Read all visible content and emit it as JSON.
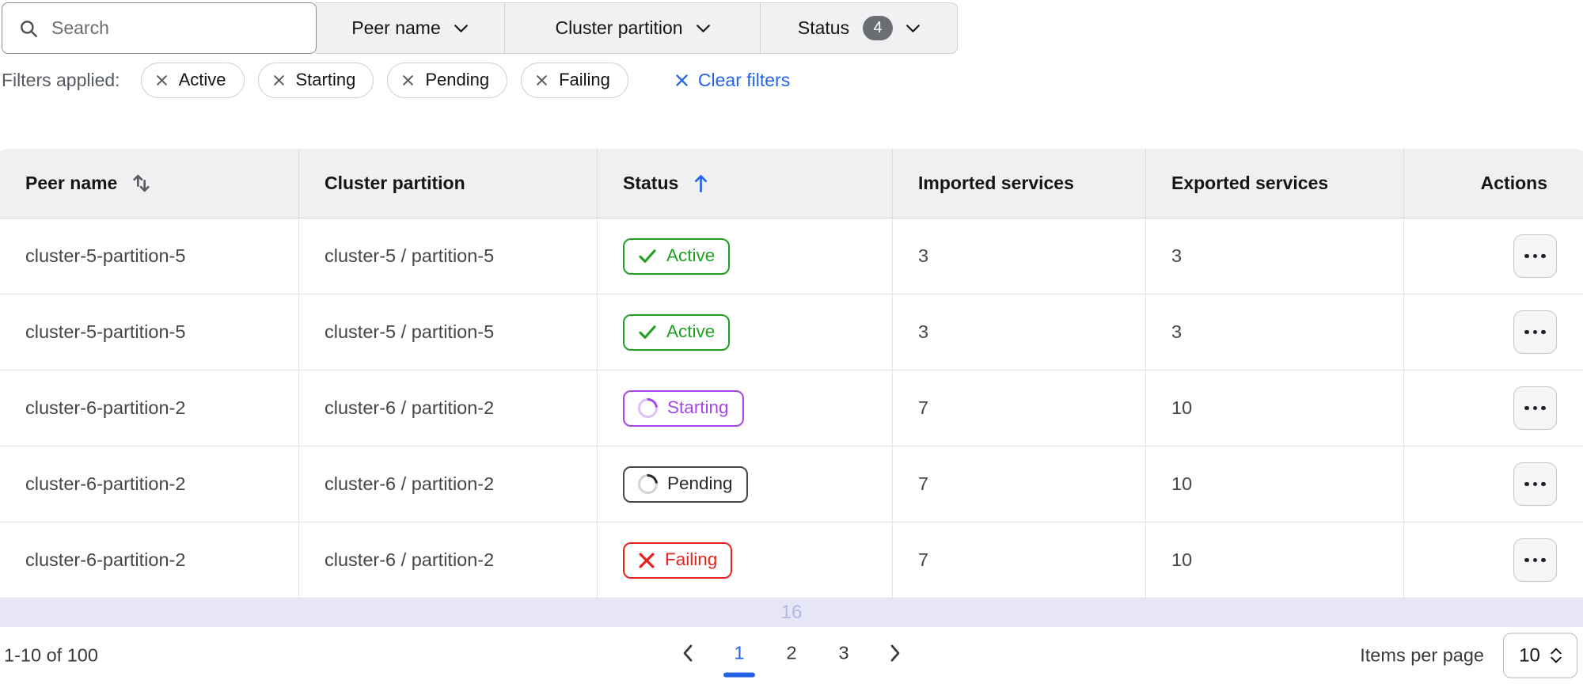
{
  "toolbar": {
    "search": {
      "placeholder": "Search",
      "icon": "search-icon"
    },
    "filters": [
      {
        "label": "Peer name",
        "icon": "chevron-down-icon"
      },
      {
        "label": "Cluster partition",
        "icon": "chevron-down-icon"
      },
      {
        "label": "Status",
        "badge_count": "4",
        "icon": "chevron-down-icon"
      }
    ]
  },
  "applied_filters": {
    "label": "Filters applied:",
    "chips": [
      {
        "label": "Active",
        "icon": "close-icon"
      },
      {
        "label": "Starting",
        "icon": "close-icon"
      },
      {
        "label": "Pending",
        "icon": "close-icon"
      },
      {
        "label": "Failing",
        "icon": "close-icon"
      }
    ],
    "clear_label": "Clear filters"
  },
  "table": {
    "columns": [
      {
        "label": "Peer name",
        "sort": "sortable"
      },
      {
        "label": "Cluster partition",
        "sort": "none"
      },
      {
        "label": "Status",
        "sort": "ascending"
      },
      {
        "label": "Imported services",
        "sort": "none"
      },
      {
        "label": "Exported services",
        "sort": "none"
      },
      {
        "label": "Actions",
        "sort": "none"
      }
    ],
    "rows": [
      {
        "peer_name": "cluster-5-partition-5",
        "cluster_partition": "cluster-5 / partition-5",
        "status": "Active",
        "imported": "3",
        "exported": "3",
        "actions_icon": "ellipsis-icon"
      },
      {
        "peer_name": "cluster-5-partition-5",
        "cluster_partition": "cluster-5 / partition-5",
        "status": "Active",
        "imported": "3",
        "exported": "3",
        "actions_icon": "ellipsis-icon"
      },
      {
        "peer_name": "cluster-6-partition-2",
        "cluster_partition": "cluster-6 / partition-2",
        "status": "Starting",
        "imported": "7",
        "exported": "10",
        "actions_icon": "ellipsis-icon"
      },
      {
        "peer_name": "cluster-6-partition-2",
        "cluster_partition": "cluster-6 / partition-2",
        "status": "Pending",
        "imported": "7",
        "exported": "10",
        "actions_icon": "ellipsis-icon"
      },
      {
        "peer_name": "cluster-6-partition-2",
        "cluster_partition": "cluster-6 / partition-2",
        "status": "Failing",
        "imported": "7",
        "exported": "10",
        "actions_icon": "ellipsis-icon"
      }
    ],
    "partial_row": {
      "text": "16"
    }
  },
  "pagination": {
    "range": "1-10 of 100",
    "pages": [
      "1",
      "2",
      "3"
    ],
    "active_page": "1",
    "items_per_page_label": "Items per page",
    "items_per_page_value": "10"
  },
  "colors": {
    "accent_blue": "#2563eb",
    "status_active_green": "#21a121",
    "status_starting_purple": "#a446eb",
    "status_pending_dark": "#45484d",
    "status_failing_red": "#e3231e",
    "filter_count_badge_bg": "#6a6e73",
    "partial_row_bg": "#e6e6f7",
    "partial_row_text": "#b4b6ec",
    "table_header_bg": "#f0f0f2"
  }
}
